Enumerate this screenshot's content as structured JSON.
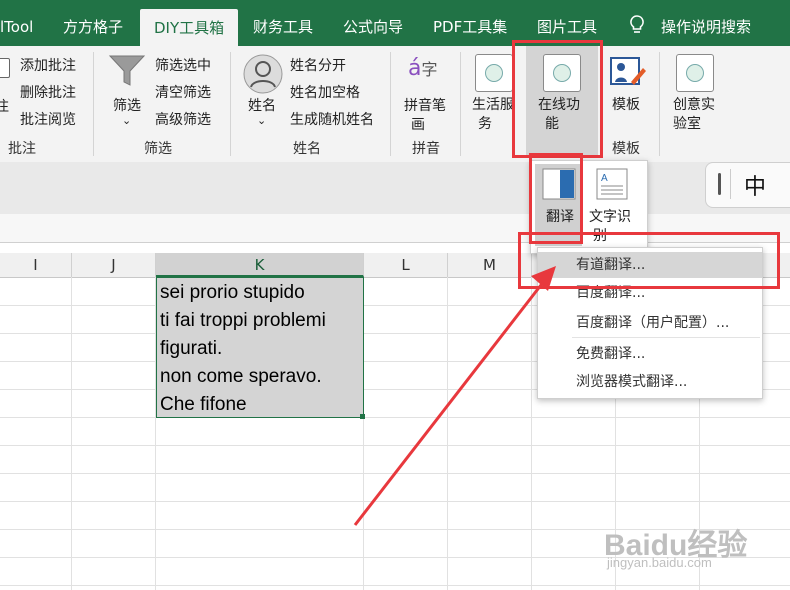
{
  "ribbon": {
    "tabs": [
      "lTool",
      "方方格子",
      "DIY工具箱",
      "财务工具",
      "公式向导",
      "PDF工具集",
      "图片工具",
      "操作说明搜索"
    ],
    "active_tab": "DIY工具箱",
    "comments": {
      "items": [
        "添加批注",
        "删除批注",
        "批注阅览"
      ],
      "left_clipped": "注",
      "group": "批注"
    },
    "filter": {
      "big": "筛选",
      "items": [
        "筛选选中",
        "清空筛选",
        "高级筛选"
      ],
      "group": "筛选"
    },
    "name": {
      "big": "姓名",
      "items": [
        "姓名分开",
        "姓名加空格",
        "生成随机姓名"
      ],
      "group": "姓名"
    },
    "pinyin": {
      "big_line1": "拼音笔",
      "big_line2": "画",
      "group": "拼音"
    },
    "life": {
      "line1": "生活服",
      "line2": "务"
    },
    "online": {
      "line1": "在线功",
      "line2": "能"
    },
    "template": {
      "big": "模板",
      "group": "模板"
    },
    "creative": {
      "line1": "创意实",
      "line2": "验室"
    }
  },
  "online_dropdown": {
    "translate_label": "翻译",
    "ocr_line1": "文字识",
    "ocr_line2": "别",
    "menu": [
      "有道翻译...",
      "百度翻译...",
      "百度翻译（用户配置）...",
      "免费翻译...",
      "浏览器模式翻译..."
    ]
  },
  "ime": {
    "mode": "中"
  },
  "sheet": {
    "columns": [
      "I",
      "J",
      "K",
      "L",
      "M"
    ],
    "selected_column": "K",
    "cells": [
      "sei prorio stupido",
      "ti fai troppi problemi",
      "figurati.",
      "non come speravo.",
      "Che fifone"
    ]
  },
  "watermark": {
    "brand": "Baidu经验",
    "url": "jingyan.baidu.com"
  },
  "colors": {
    "accent": "#217346",
    "highlight_box": "#e8383d"
  }
}
